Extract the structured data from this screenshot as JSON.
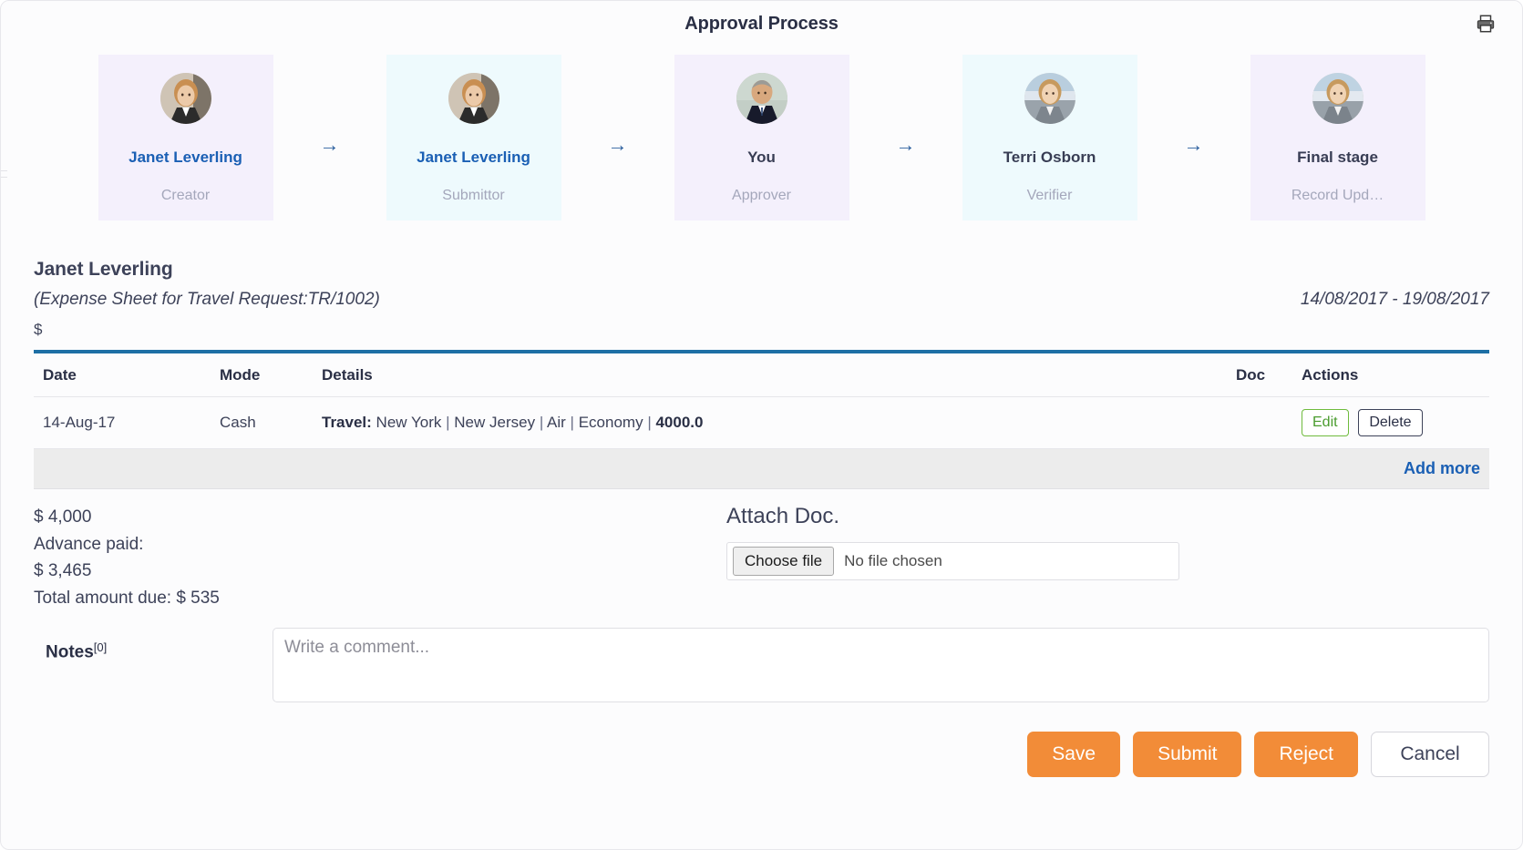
{
  "header": {
    "title": "Approval Process",
    "print_icon": "printer-icon"
  },
  "stages": [
    {
      "name": "Janet Leverling",
      "role": "Creator",
      "tint": "lav",
      "name_style": "accent",
      "avatar": "woman-1-avatar"
    },
    {
      "name": "Janet Leverling",
      "role": "Submittor",
      "tint": "cyan",
      "name_style": "accent",
      "avatar": "woman-1-avatar"
    },
    {
      "name": "You",
      "role": "Approver",
      "tint": "lav",
      "name_style": "dark",
      "avatar": "man-1-avatar"
    },
    {
      "name": "Terri Osborn",
      "role": "Verifier",
      "tint": "cyan",
      "name_style": "dark",
      "avatar": "woman-2-avatar"
    },
    {
      "name": "Final stage",
      "role": "Record Upd…",
      "tint": "lav",
      "name_style": "dark",
      "avatar": "woman-3-avatar"
    }
  ],
  "arrow_glyph": "→",
  "detail": {
    "person_name": "Janet Leverling",
    "subtitle": "(Expense Sheet for Travel Request:TR/1002)",
    "date_range": "14/08/2017  -  19/08/2017",
    "currency": "$"
  },
  "table": {
    "columns": {
      "date": "Date",
      "mode": "Mode",
      "details": "Details",
      "doc": "Doc",
      "actions": "Actions"
    },
    "rows": [
      {
        "date": "14-Aug-17",
        "mode": "Cash",
        "details_label": "Travel:",
        "details_from": "New York",
        "details_to": "New Jersey",
        "details_transport": "Air",
        "details_class": "Economy",
        "details_amount": "4000.0",
        "doc": "",
        "edit_label": "Edit",
        "delete_label": "Delete"
      }
    ],
    "add_more_label": "Add more"
  },
  "summary": {
    "total_line": "$ 4,000",
    "advance_label": "Advance paid:",
    "advance_value": "$ 3,465",
    "due_line": "Total amount due: $ 535"
  },
  "attach": {
    "title": "Attach Doc.",
    "choose_label": "Choose file",
    "status": "No file chosen"
  },
  "notes": {
    "label": "Notes",
    "count": "[0]",
    "placeholder": "Write a comment...",
    "value": ""
  },
  "footer": {
    "save": "Save",
    "submit": "Submit",
    "reject": "Reject",
    "cancel": "Cancel"
  },
  "colors": {
    "accent_orange": "#f28c38",
    "link_blue": "#1a5fb4",
    "table_top_border": "#1d6fa5",
    "edit_green": "#4a9c2e",
    "tint_lavender": "#f4f0fc",
    "tint_cyan": "#eefafd"
  }
}
